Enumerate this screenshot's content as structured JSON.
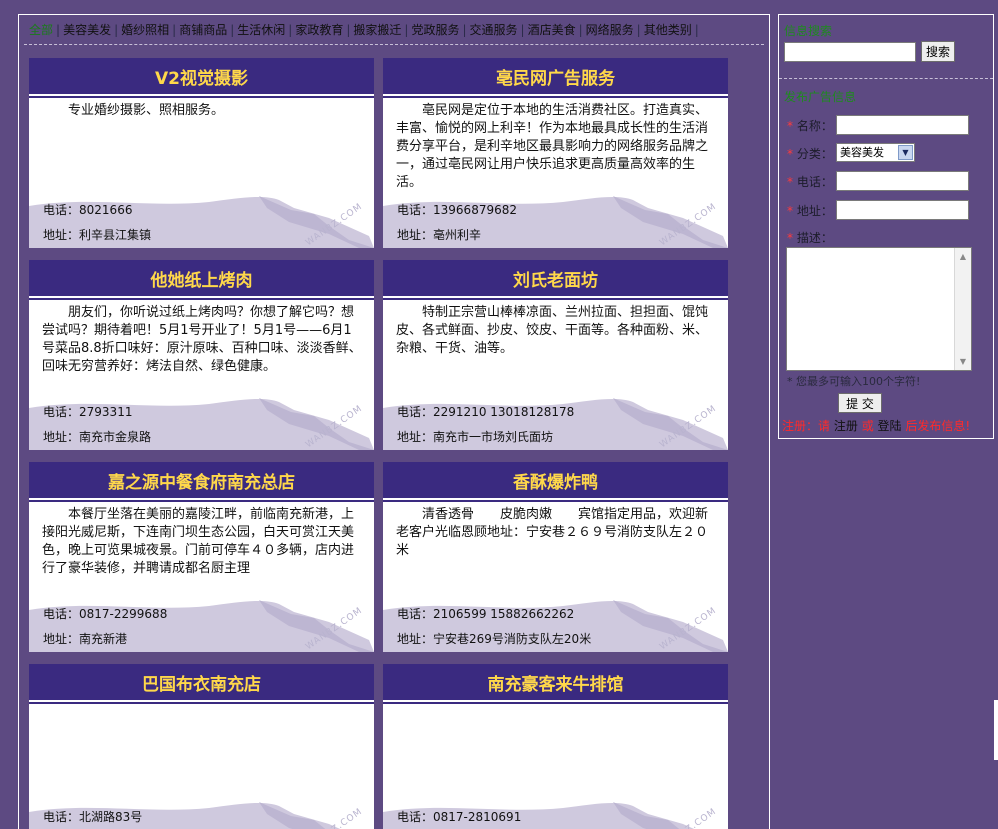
{
  "nav": {
    "items": [
      "全部",
      "美容美发",
      "婚纱照相",
      "商铺商品",
      "生活休闲",
      "家政教育",
      "搬家搬迁",
      "党政服务",
      "交通服务",
      "酒店美食",
      "网络服务",
      "其他类别"
    ]
  },
  "labels": {
    "phone": "电话：",
    "address": "地址：",
    "watermark": "WANBZ.COM"
  },
  "cards": [
    {
      "title": "V2视觉摄影",
      "desc": "专业婚纱摄影、照相服务。",
      "phone": "8021666",
      "address": "利辛县江集镇"
    },
    {
      "title": "亳民网广告服务",
      "desc": "亳民网是定位于本地的生活消费社区。打造真实、丰富、愉悦的网上利辛！作为本地最具成长性的生活消费分享平台，是利辛地区最具影响力的网络服务品牌之一，通过亳民网让用户快乐追求更高质量高效率的生活。",
      "phone": "13966879682",
      "address": "亳州利辛"
    },
    {
      "title": "他她纸上烤肉",
      "desc": "朋友们，你听说过纸上烤肉吗？你想了解它吗？想尝试吗？期待着吧！5月1号开业了！5月1号——6月1号菜品8.8折口味好：原汁原味、百种口味、淡淡香鲜、回味无穷营养好：烤法自然、绿色健康。",
      "phone": "2793311",
      "address": "南充市金泉路"
    },
    {
      "title": "刘氏老面坊",
      "desc": "特制正宗营山棒棒凉面、兰州拉面、担担面、馄饨皮、各式鲜面、抄皮、饺皮、干面等。各种面粉、米、杂粮、干货、油等。",
      "phone": "2291210 13018128178",
      "address": "南充市一市场刘氏面坊"
    },
    {
      "title": "嘉之源中餐食府南充总店",
      "desc": "本餐厅坐落在美丽的嘉陵江畔，前临南充新港，上接阳光威尼斯，下连南门坝生态公园，白天可赏江天美色，晚上可览果城夜景。门前可停车４０多辆，店内进行了豪华装修，并聘请成都名厨主理",
      "phone": "0817-2299688",
      "address": "南充新港"
    },
    {
      "title": "香酥爆炸鸭",
      "desc": "清香透骨　　皮脆肉嫩　　宾馆指定用品，欢迎新老客户光临恩顾地址：宁安巷２６９号消防支队左２０米",
      "phone": "2106599 15882662262",
      "address": "宁安巷269号消防支队左20米"
    },
    {
      "title": "巴国布衣南充店",
      "desc": "",
      "phone": "北湖路83号",
      "address": ""
    },
    {
      "title": "南充豪客来牛排馆",
      "desc": "",
      "phone": "0817-2810691",
      "address": ""
    }
  ],
  "sidebar": {
    "search_title": "信息搜索",
    "search_button": "搜索",
    "post_title": "发布广告信息",
    "form": {
      "name_label": "名称：",
      "category_label": "分类：",
      "category_value": "美容美发",
      "phone_label": "电话：",
      "address_label": "地址：",
      "desc_label": "描述：",
      "required_mark": "*",
      "hint": "* 您最多可输入100个字符!",
      "submit": "提 交"
    },
    "auth": {
      "prefix": "注册：",
      "sep1": "请",
      "register": "注册",
      "sep2": "或",
      "login": "登陆",
      "suffix": "后发布信息!"
    }
  },
  "colors": {
    "page_bg": "#5d4a82",
    "card_header_bg": "#3a2a80",
    "card_title": "#ffd84a",
    "accent_green": "#1e8a1e",
    "warn_red": "#ff2a2a"
  }
}
